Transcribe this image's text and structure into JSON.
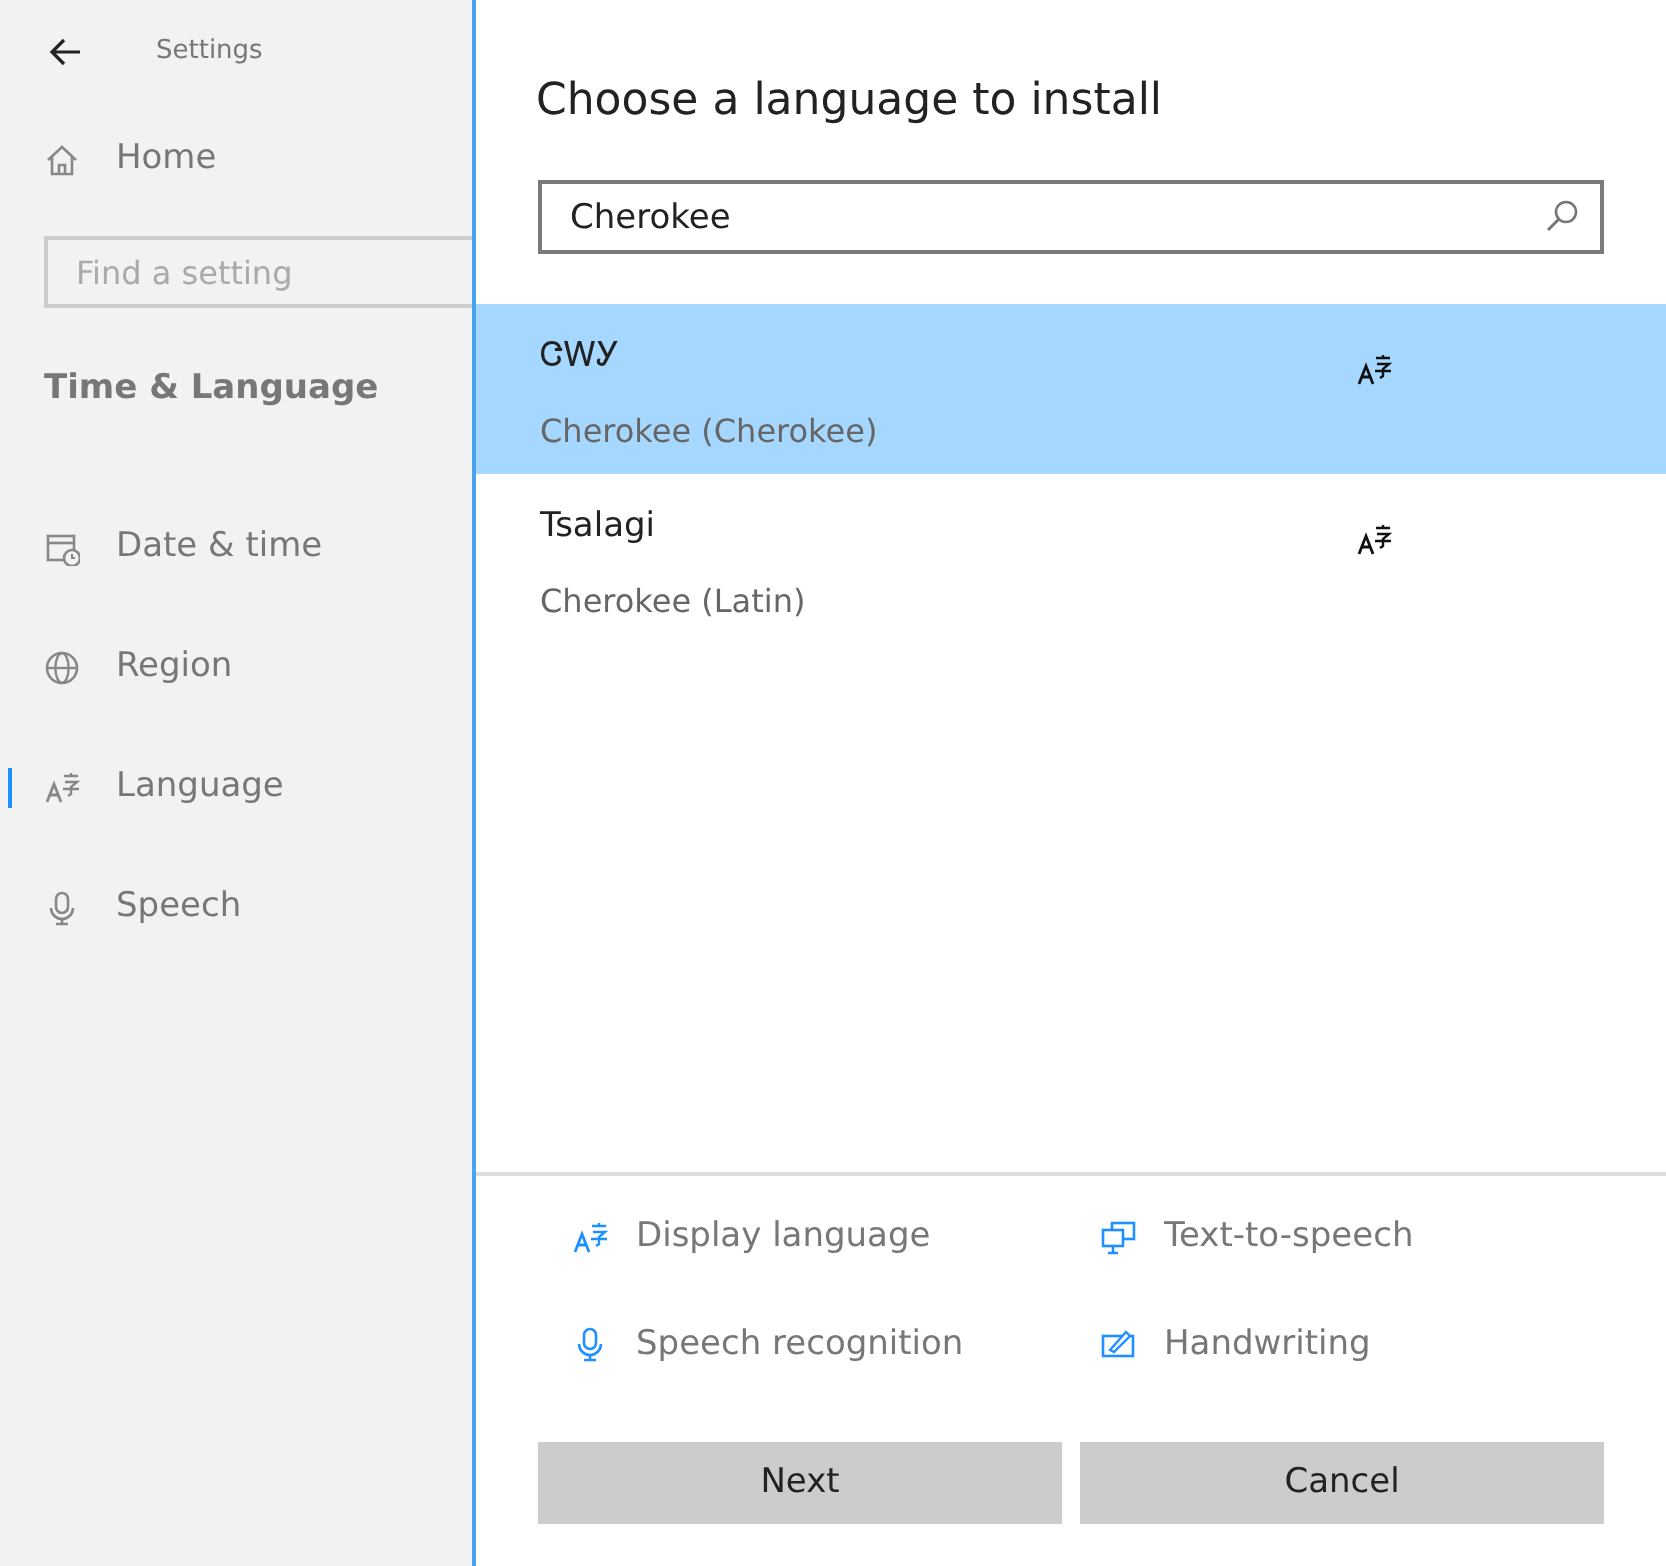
{
  "sidebar": {
    "title": "Settings",
    "home": "Home",
    "search": {
      "placeholder": "Find a setting"
    },
    "section": "Time & Language",
    "items": [
      {
        "label": "Date & time",
        "kind": "calendar",
        "selected": false
      },
      {
        "label": "Region",
        "kind": "globe",
        "selected": false
      },
      {
        "label": "Language",
        "kind": "language",
        "selected": true
      },
      {
        "label": "Speech",
        "kind": "mic",
        "selected": false
      }
    ]
  },
  "dialog": {
    "title": "Choose a language to install",
    "search": {
      "value": "Cherokee"
    },
    "languages": [
      {
        "name": "ᏣᎳᎩ",
        "description": "Cherokee (Cherokee)",
        "selected": true
      },
      {
        "name": "Tsalagi",
        "description": "Cherokee (Latin)",
        "selected": false
      }
    ],
    "features": [
      {
        "label": "Display language",
        "kind": "language"
      },
      {
        "label": "Text-to-speech",
        "kind": "monitor"
      },
      {
        "label": "Speech recognition",
        "kind": "mic"
      },
      {
        "label": "Handwriting",
        "kind": "pen"
      }
    ],
    "buttons": [
      "Next",
      "Cancel"
    ]
  }
}
